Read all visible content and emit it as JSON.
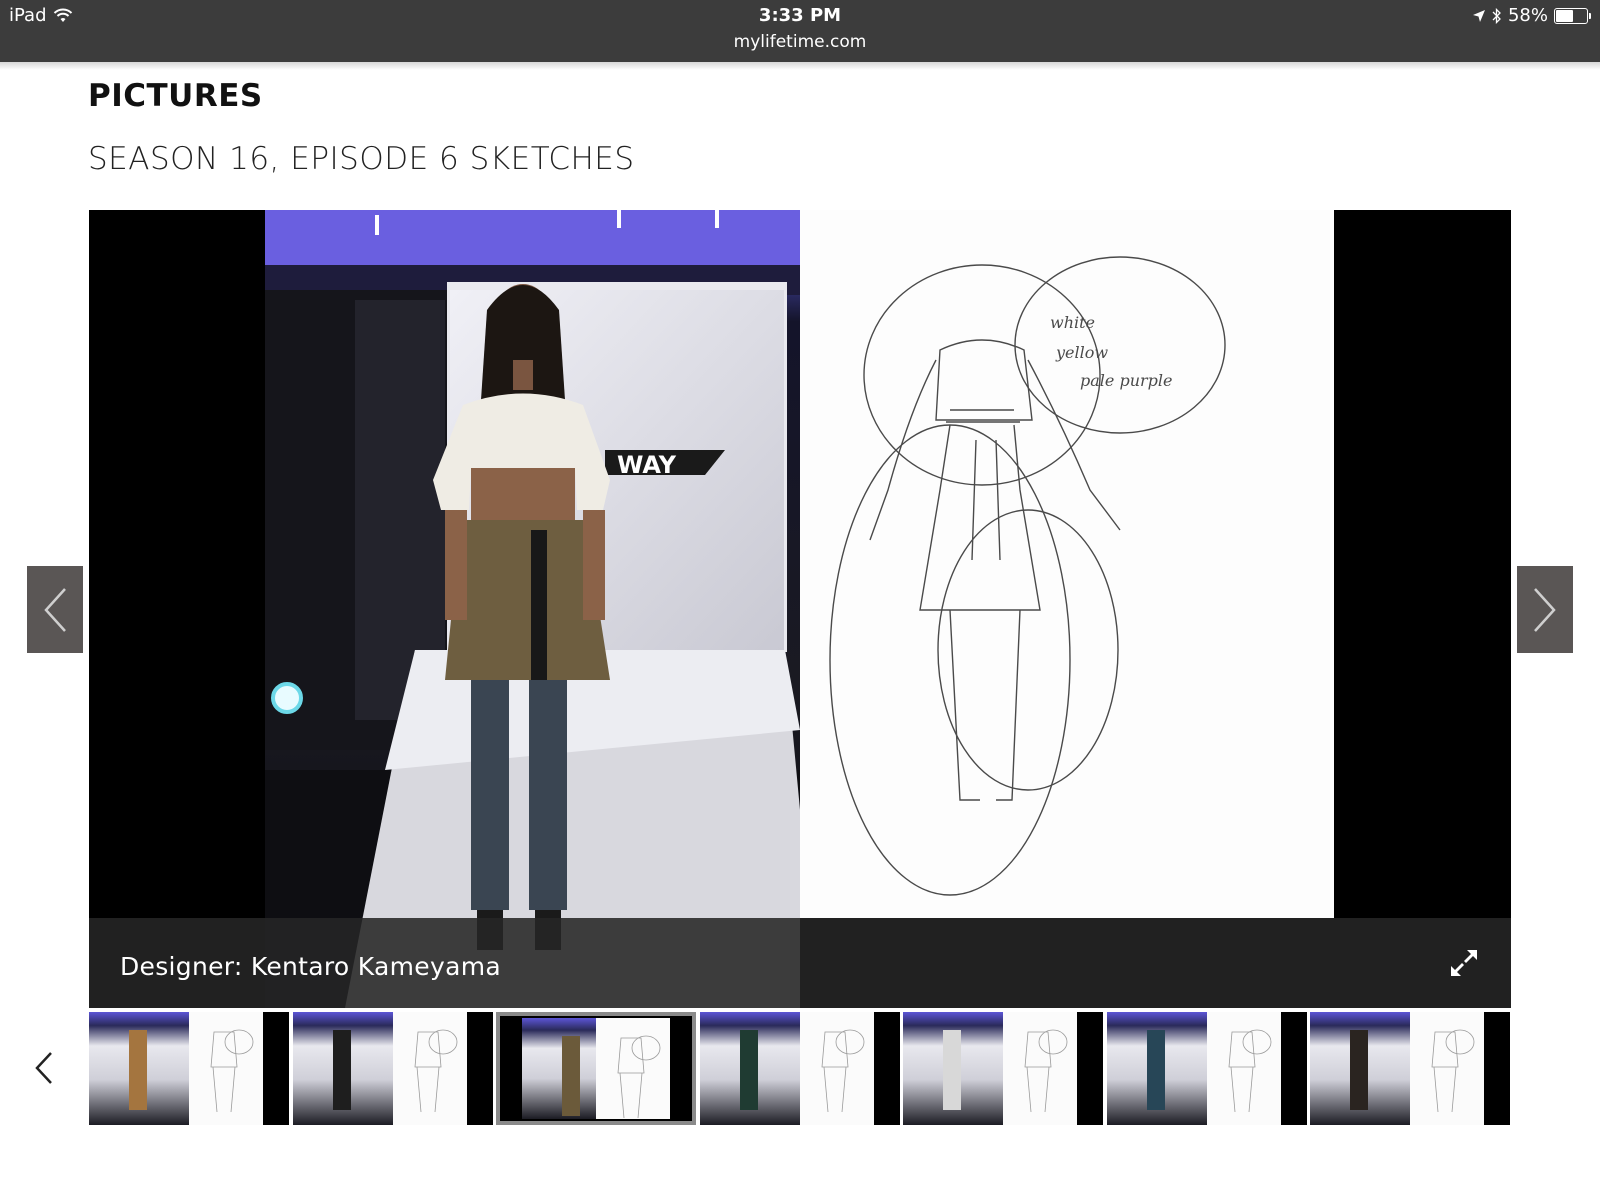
{
  "status_bar": {
    "device": "iPad",
    "time": "3:33 PM",
    "url": "mylifetime.com",
    "battery": "58%",
    "battery_level": 0.58
  },
  "page": {
    "section_heading": "PICTURES",
    "gallery_title": "SEASON 16, EPISODE 6 SKETCHES"
  },
  "slide": {
    "caption": "Designer: Kentaro Kameyama",
    "sketch_notes": [
      "white",
      "yellow",
      "pale purple"
    ],
    "backdrop_text": "WAY"
  },
  "thumbnails": {
    "count": 7,
    "active_index": 2,
    "outfit_colors": [
      "#a4753f",
      "#1e1e1e",
      "#6b5a3a",
      "#1f3b32",
      "#d8d8d8",
      "#274657",
      "#2a2420"
    ]
  },
  "colors": {
    "status_bar": "#3c3c3c",
    "nav_button": "#5a5655",
    "caption_bar": "#262626",
    "stage_purple": "#5c55d6"
  },
  "icons": {
    "wifi": "wifi-icon",
    "location": "location-arrow-icon",
    "bluetooth": "bluetooth-icon",
    "expand": "expand-icon",
    "prev": "chevron-left-icon",
    "next": "chevron-right-icon"
  }
}
